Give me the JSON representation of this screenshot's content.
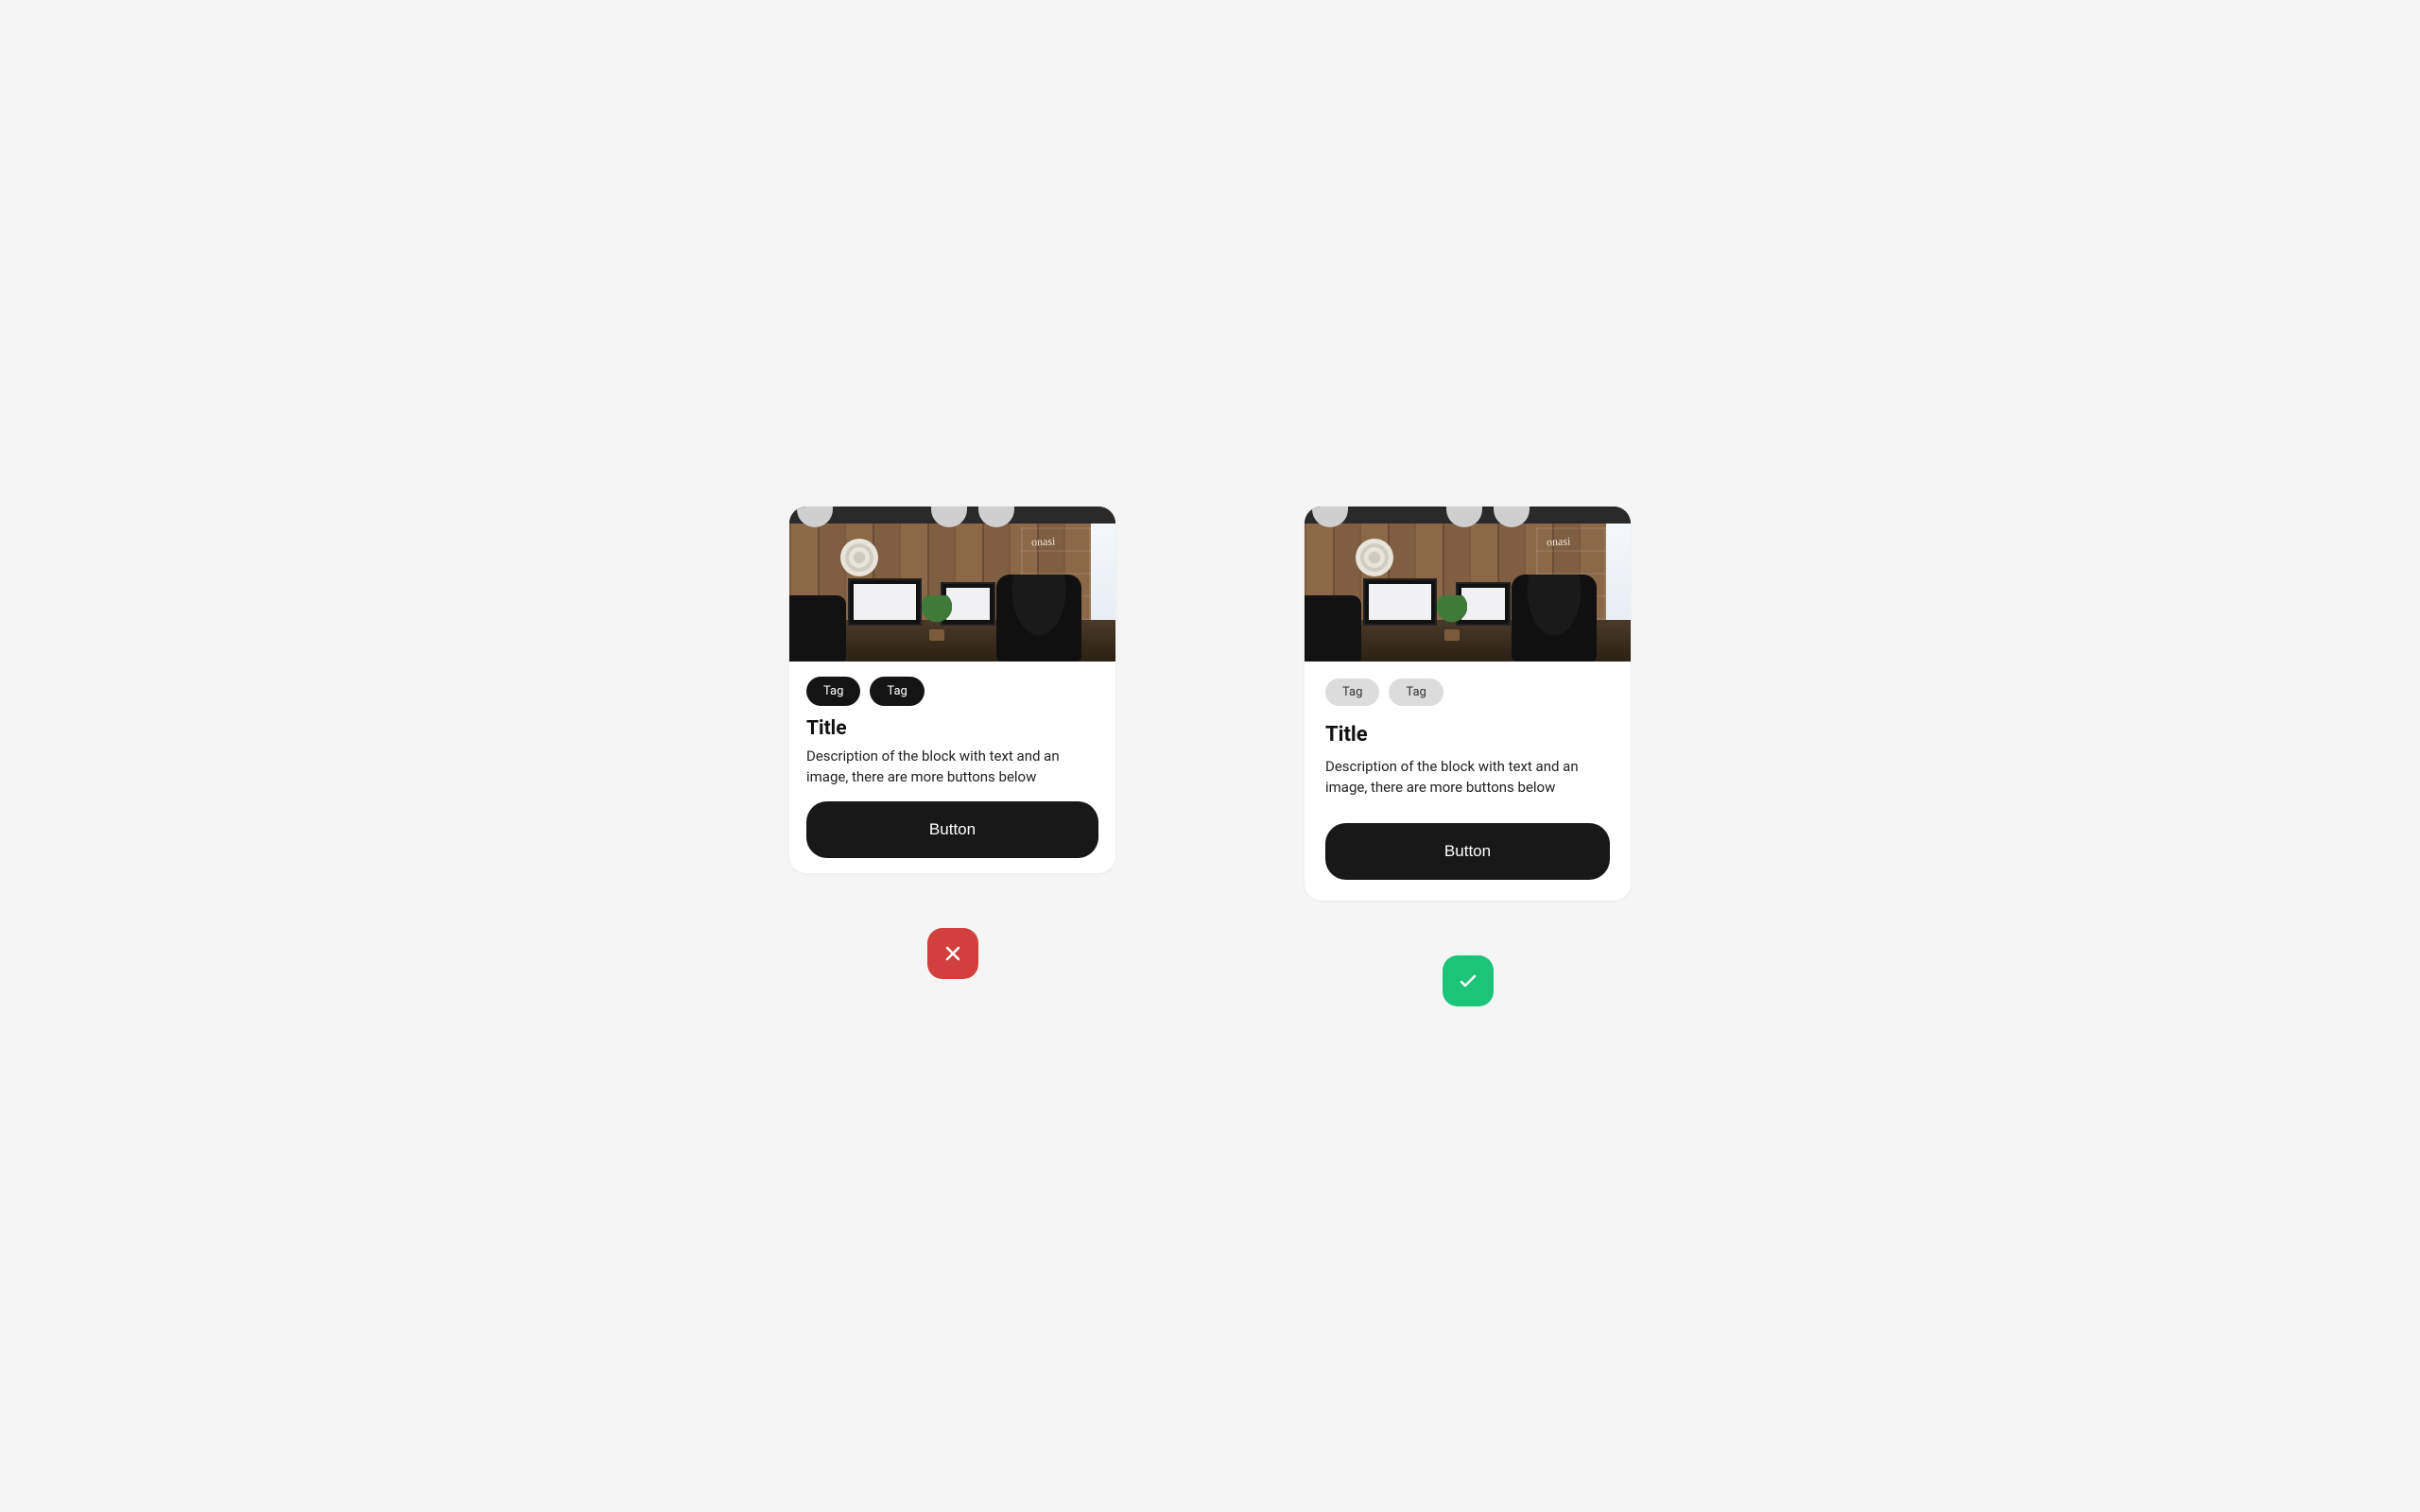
{
  "bad": {
    "tags": [
      "Tag",
      "Tag"
    ],
    "title": "Title",
    "description": "Description of the block with text and an image, there are more buttons below",
    "button": "Button",
    "verdict": "incorrect"
  },
  "good": {
    "tags": [
      "Tag",
      "Tag"
    ],
    "title": "Title",
    "description": "Description of the block with text and an image, there are more buttons below",
    "button": "Button",
    "verdict": "correct"
  }
}
